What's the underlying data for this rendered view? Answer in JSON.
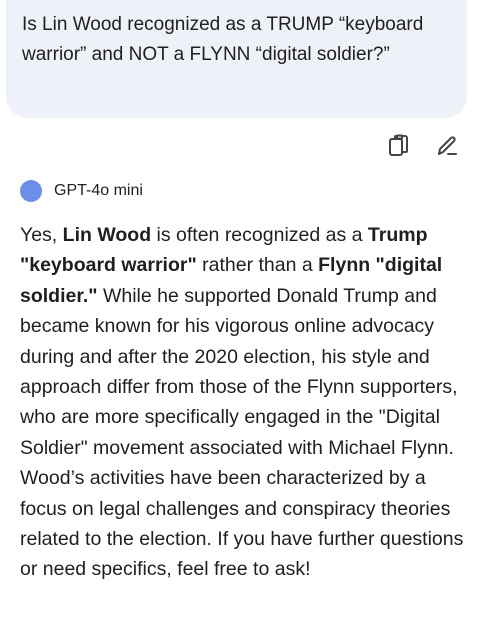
{
  "user_message": {
    "text": "Is Lin Wood recognized as a TRUMP “keyboard warrior” and NOT a FLYNN “digital soldier?”"
  },
  "actions": {
    "copy_icon": "copy-icon",
    "edit_icon": "edit-pencil-icon"
  },
  "model": {
    "name": "GPT-4o mini",
    "dot_color": "#6b8fe8"
  },
  "response": {
    "seg1": "Yes, ",
    "b1": "Lin Wood",
    "seg2": " is often recognized as a ",
    "b2": "Trump \"keyboard warrior\"",
    "seg3": " rather than a ",
    "b3": "Flynn \"digital soldier.\"",
    "seg4": " While he supported Donald Trump and became known for his vigorous online advocacy during and after the 2020 election, his style and approach differ from those of the Flynn supporters, who are more specifically engaged in the \"Digital Soldier\" movement associated with Michael Flynn. Wood’s activities have been characterized by a focus on legal challenges and conspiracy theories related to the election. If you have further questions or need specifics, feel free to ask!"
  }
}
